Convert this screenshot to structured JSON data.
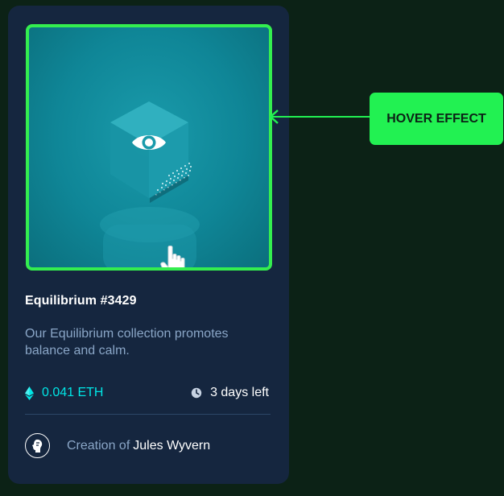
{
  "nft": {
    "title": "Equilibrium #3429",
    "description": "Our Equilibrium collection promotes balance and calm.",
    "price": "0.041 ETH",
    "time_left": "3 days left",
    "creator_prefix": "Creation of",
    "creator_name": "Jules Wyvern"
  },
  "annotation": {
    "label": "HOVER EFFECT"
  },
  "icons": {
    "view": "eye-icon",
    "pointer": "hand-cursor-icon",
    "currency": "ethereum-icon",
    "time": "clock-icon",
    "avatar": "avatar-icon"
  },
  "colors": {
    "page_background": "#0c2216",
    "card_background": "#15263f",
    "hover_border": "#34ee4f",
    "annotation_tag": "#22f152",
    "price_cyan": "#00e6e6",
    "muted_text": "#8aa6c7"
  }
}
